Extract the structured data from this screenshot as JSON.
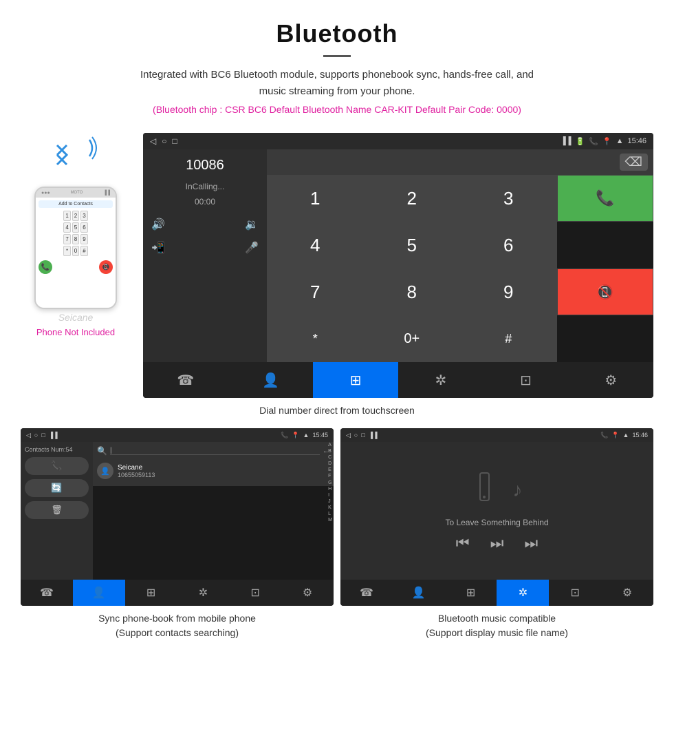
{
  "header": {
    "title": "Bluetooth",
    "description": "Integrated with BC6 Bluetooth module, supports phonebook sync, hands-free call, and music streaming from your phone.",
    "specs": "(Bluetooth chip : CSR BC6    Default Bluetooth Name CAR-KIT    Default Pair Code: 0000)"
  },
  "phone_mockup": {
    "add_to_contacts": "Add to Contacts",
    "keys": [
      "1",
      "2",
      "3",
      "4",
      "5",
      "6",
      "7",
      "8",
      "9",
      "*",
      "0",
      "#"
    ]
  },
  "phone_not_included": "Phone Not Included",
  "seicane_label": "Seicane",
  "car_unit": {
    "status_bar": {
      "time": "15:46"
    },
    "dialer": {
      "number": "10086",
      "status": "InCalling...",
      "timer": "00:00"
    },
    "numpad": {
      "keys": [
        "1",
        "2",
        "3",
        "*",
        "4",
        "5",
        "6",
        "0+",
        "7",
        "8",
        "9",
        "#"
      ]
    },
    "nav_items": [
      "☎",
      "👤",
      "⊞",
      "✳",
      "⊡",
      "⚙"
    ]
  },
  "dial_caption": "Dial number direct from touchscreen",
  "contacts_unit": {
    "status_bar": {
      "time": "15:45"
    },
    "contacts_num": "Contacts Num:54",
    "contact": {
      "name": "Seicane",
      "phone": "10655059113"
    },
    "alpha": [
      "A",
      "B",
      "C",
      "D",
      "E",
      "F",
      "G",
      "H",
      "I",
      "J",
      "K",
      "L",
      "M"
    ],
    "nav_items": [
      "☎",
      "👤",
      "⊞",
      "✳",
      "⊡",
      "⚙"
    ]
  },
  "contacts_caption_line1": "Sync phone-book from mobile phone",
  "contacts_caption_line2": "(Support contacts searching)",
  "music_unit": {
    "status_bar": {
      "time": "15:46"
    },
    "song_title": "To Leave Something Behind",
    "nav_items": [
      "☎",
      "👤",
      "⊞",
      "✳",
      "⊡",
      "⚙"
    ]
  },
  "music_caption_line1": "Bluetooth music compatible",
  "music_caption_line2": "(Support display music file name)"
}
